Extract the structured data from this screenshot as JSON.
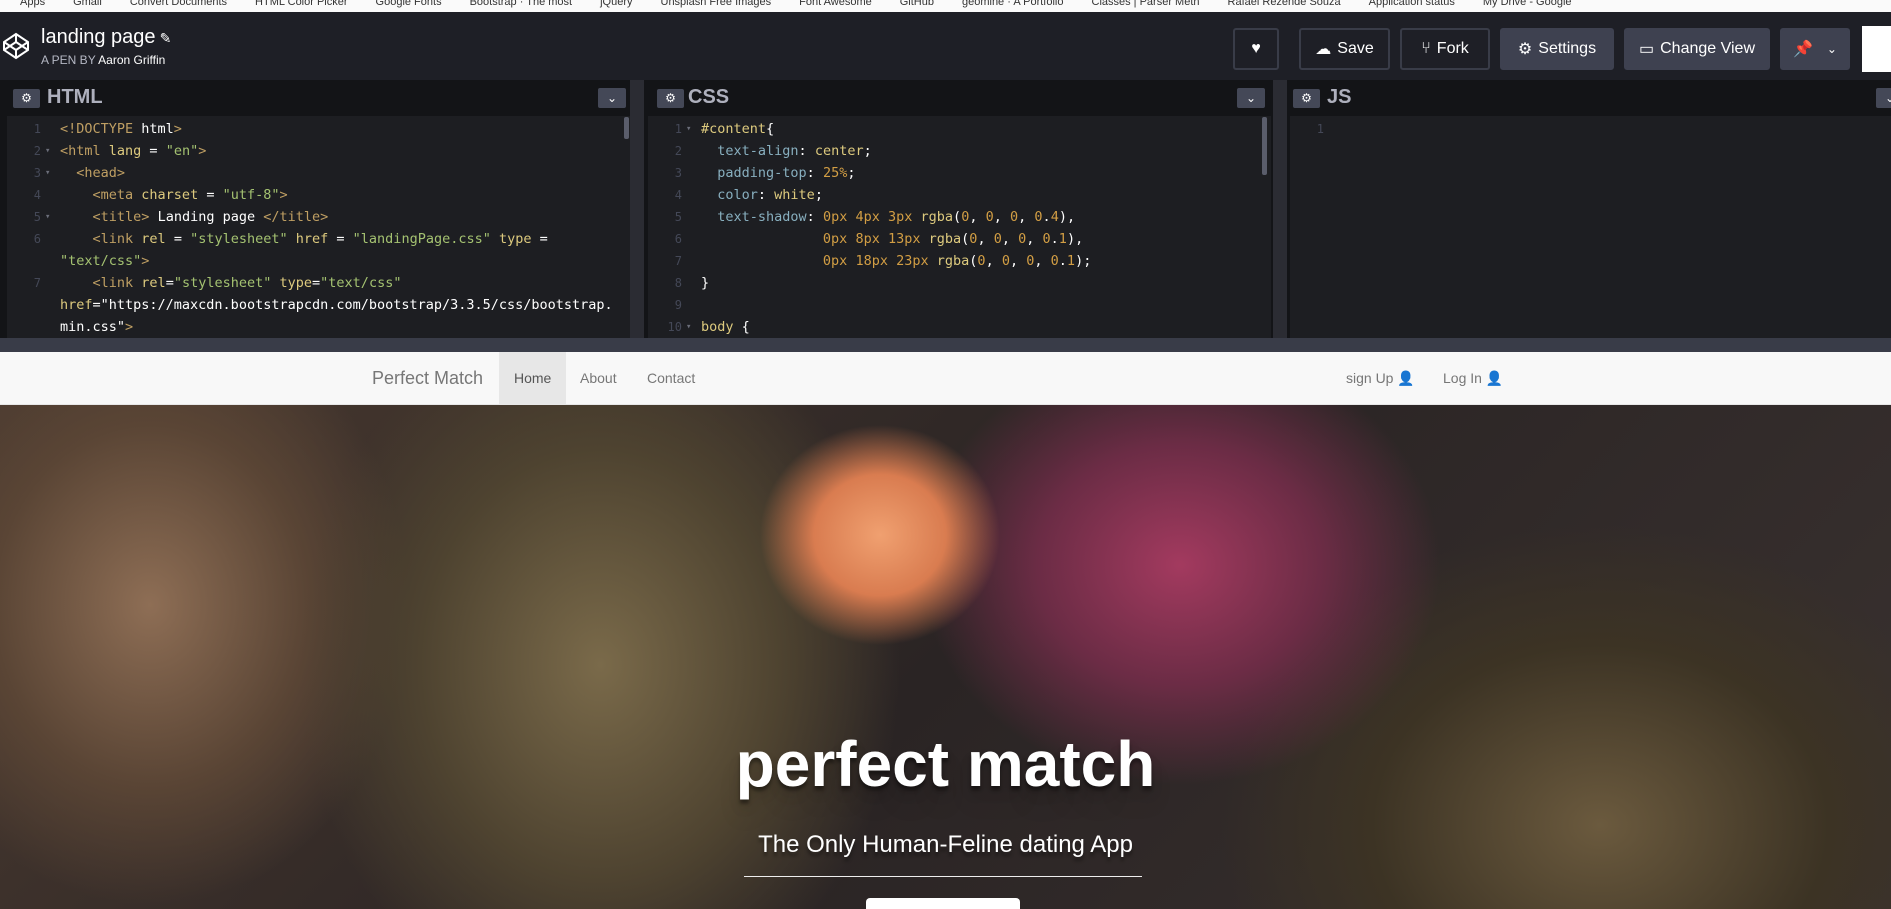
{
  "bookmarks": [
    "Apps",
    "Gmail",
    "Convert Documents",
    "HTML Color Picker",
    "Google Fonts",
    "Bootstrap · The most",
    "jQuery",
    "Unsplash Free Images",
    "Font Awesome",
    "GitHub",
    "geomine · A Portfolio",
    "Classes | Parser Meth",
    "Rafael Rezende Souza",
    "Application status",
    "My Drive - Google"
  ],
  "header": {
    "title": "landing page",
    "author_prefix": "A PEN BY",
    "author": "Aaron Griffin",
    "buttons": {
      "save": "Save",
      "fork": "Fork",
      "settings": "Settings",
      "change_view": "Change View"
    }
  },
  "panes": {
    "html": {
      "title": "HTML"
    },
    "css": {
      "title": "CSS"
    },
    "js": {
      "title": "JS"
    }
  },
  "html_code": [
    "<!DOCTYPE html>",
    "<html lang = \"en\">",
    "  <head>",
    "    <meta charset = \"utf-8\">",
    "    <title> Landing page </title>",
    "    <link rel = \"stylesheet\" href = \"landingPage.css\" type =",
    "\"text/css\">",
    "    <link rel=\"stylesheet\" type=\"text/css\"",
    "href=\"https://maxcdn.bootstrapcdn.com/bootstrap/3.3.5/css/bootstrap.",
    "min.css\">"
  ],
  "html_line_numbers": [
    "1",
    "2",
    "3",
    "4",
    "5",
    "6",
    "",
    "7",
    "",
    ""
  ],
  "css_code": [
    "#content{",
    "  text-align: center;",
    "  padding-top: 25%;",
    "  color: white;",
    "  text-shadow: 0px 4px 3px rgba(0, 0, 0, 0.4),",
    "               0px 8px 13px rgba(0, 0, 0, 0.1),",
    "               0px 18px 23px rgba(0, 0, 0, 0.1);",
    "}",
    "",
    "body {"
  ],
  "css_line_numbers": [
    "1",
    "2",
    "3",
    "4",
    "5",
    "6",
    "7",
    "8",
    "9",
    "10"
  ],
  "js_line_numbers": [
    "1"
  ],
  "preview": {
    "brand": "Perfect Match",
    "nav": [
      "Home",
      "About",
      "Contact"
    ],
    "signup": "sign Up",
    "login": "Log In",
    "hero_title": "perfect match",
    "hero_subtitle": "The Only Human-Feline dating App"
  }
}
